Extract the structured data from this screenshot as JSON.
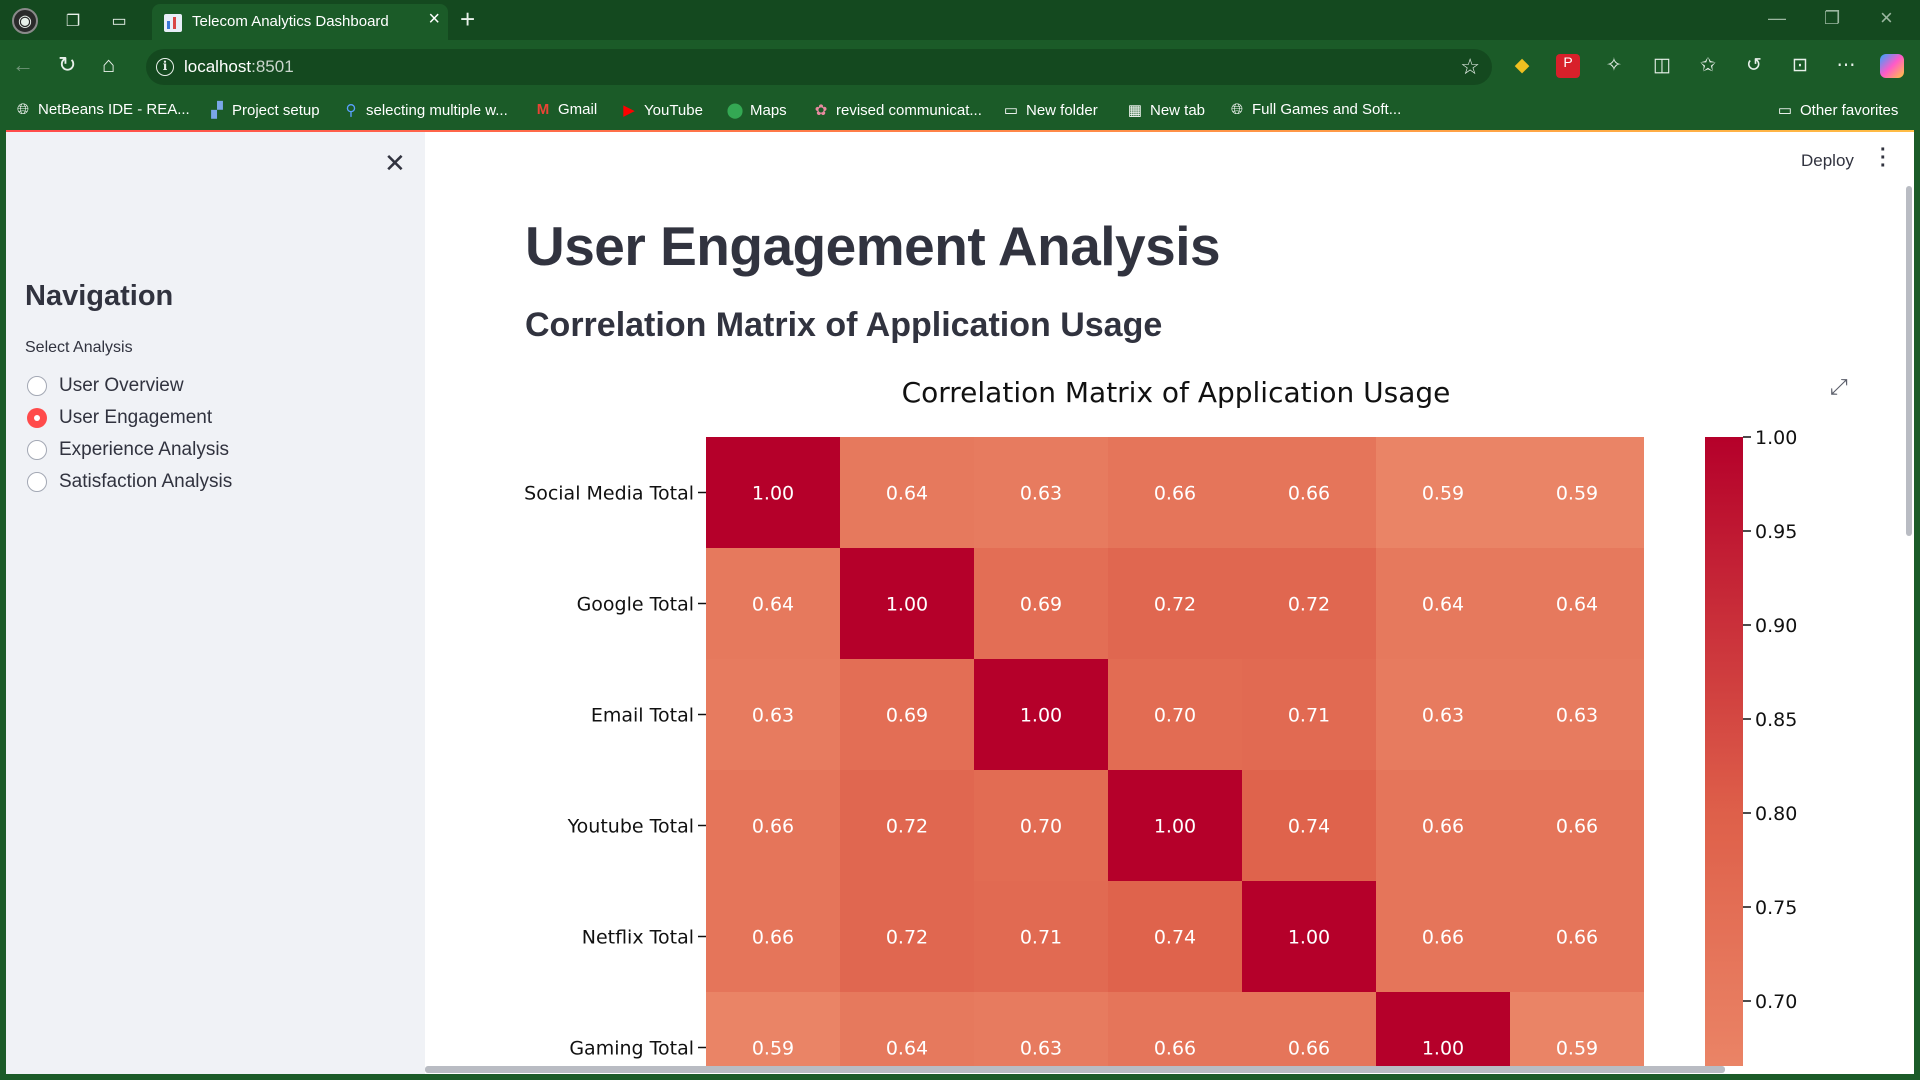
{
  "browser": {
    "tab_title": "Telecom Analytics Dashboard",
    "url_host": "localhost",
    "url_port": ":8501"
  },
  "bookmarks": [
    {
      "label": "NetBeans IDE - REA...",
      "icon": "globe-icon"
    },
    {
      "label": "Project setup",
      "icon": "project-icon"
    },
    {
      "label": "selecting multiple w...",
      "icon": "search-icon"
    },
    {
      "label": "Gmail",
      "icon": "gmail-icon"
    },
    {
      "label": "YouTube",
      "icon": "youtube-icon"
    },
    {
      "label": "Maps",
      "icon": "maps-icon"
    },
    {
      "label": "revised communicat...",
      "icon": "settings-icon"
    },
    {
      "label": "New folder",
      "icon": "folder-icon"
    },
    {
      "label": "New tab",
      "icon": "calendar-icon"
    },
    {
      "label": "Full Games and Soft...",
      "icon": "globe-icon"
    },
    {
      "label": "Other favorites",
      "icon": "folder-icon"
    }
  ],
  "sidebar": {
    "title": "Navigation",
    "select_label": "Select Analysis",
    "options": [
      {
        "label": "User Overview",
        "selected": false
      },
      {
        "label": "User Engagement",
        "selected": true
      },
      {
        "label": "Experience Analysis",
        "selected": false
      },
      {
        "label": "Satisfaction Analysis",
        "selected": false
      }
    ]
  },
  "header": {
    "deploy_label": "Deploy"
  },
  "main": {
    "title": "User Engagement Analysis",
    "subtitle": "Correlation Matrix of Application Usage"
  },
  "colors": {
    "accent": "#ff4b4b",
    "browser_chrome": "#1b5b28",
    "heatmap_max": "#b5002a",
    "heatmap_min": "#ea8466"
  },
  "chart_data": {
    "type": "heatmap",
    "title": "Correlation Matrix of Application Usage",
    "rows": [
      "Social Media Total",
      "Google Total",
      "Email Total",
      "Youtube Total",
      "Netflix Total",
      "Gaming Total"
    ],
    "values": [
      [
        1.0,
        0.64,
        0.63,
        0.66,
        0.66,
        0.59,
        0.59
      ],
      [
        0.64,
        1.0,
        0.69,
        0.72,
        0.72,
        0.64,
        0.64
      ],
      [
        0.63,
        0.69,
        1.0,
        0.7,
        0.71,
        0.63,
        0.63
      ],
      [
        0.66,
        0.72,
        0.7,
        1.0,
        0.74,
        0.66,
        0.66
      ],
      [
        0.66,
        0.72,
        0.71,
        0.74,
        1.0,
        0.66,
        0.66
      ],
      [
        0.59,
        0.64,
        0.63,
        0.66,
        0.66,
        1.0,
        0.59
      ]
    ],
    "colorbar_ticks": [
      "1.00",
      "0.95",
      "0.90",
      "0.85",
      "0.80",
      "0.75",
      "0.70"
    ],
    "color_range": [
      0.59,
      1.0
    ],
    "colormap": "coolwarm"
  }
}
